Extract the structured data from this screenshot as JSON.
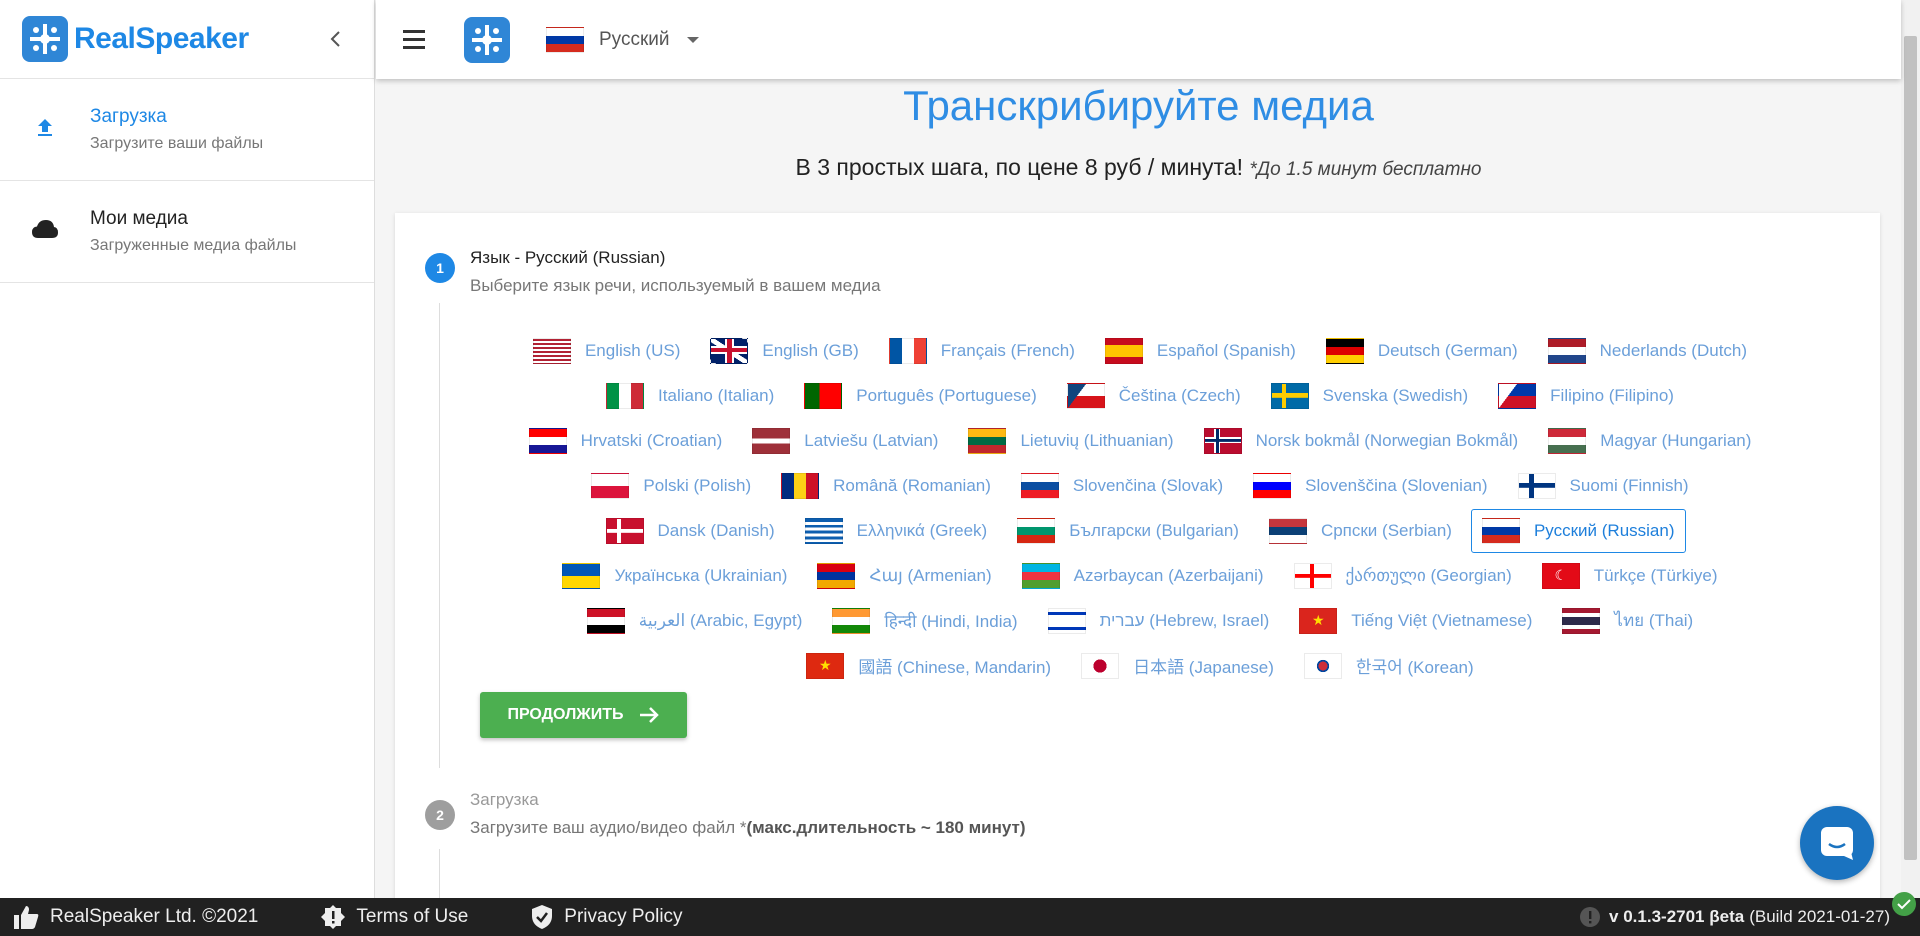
{
  "app": {
    "name": "RealSpeaker",
    "brand_color": "#1e88e5"
  },
  "sidebar": {
    "items": [
      {
        "title": "Загрузка",
        "subtitle": "Загрузите ваши файлы",
        "icon": "upload-icon",
        "active": true
      },
      {
        "title": "Мои медиа",
        "subtitle": "Загруженные медиа файлы",
        "icon": "cloud-icon",
        "active": false
      }
    ]
  },
  "topbar": {
    "selected_language": "Русский",
    "flag": "ru"
  },
  "hero": {
    "title": "Транскрибируйте медиа",
    "subtitle": "В 3 простых шага, по цене 8 руб / минута!",
    "note": "*До 1.5 минут бесплатно"
  },
  "steps": [
    {
      "num": "1",
      "title": "Язык - Русский (Russian)",
      "subtitle": "Выберите язык речи, используемый в вашем медиа"
    },
    {
      "num": "2",
      "title": "Загрузка",
      "subtitle": "Загрузите ваш аудио/видео файл *",
      "subtitle_bold": "(макс.длительность ~ 180 минут)"
    }
  ],
  "languages": [
    [
      {
        "label": "English (US)",
        "flag": "us"
      },
      {
        "label": "English (GB)",
        "flag": "gb"
      },
      {
        "label": "Français (French)",
        "flag": "fr"
      },
      {
        "label": "Español (Spanish)",
        "flag": "es"
      },
      {
        "label": "Deutsch (German)",
        "flag": "de"
      },
      {
        "label": "Nederlands (Dutch)",
        "flag": "nl"
      }
    ],
    [
      {
        "label": "Italiano (Italian)",
        "flag": "it"
      },
      {
        "label": "Português (Portuguese)",
        "flag": "pt"
      },
      {
        "label": "Čeština (Czech)",
        "flag": "cz"
      },
      {
        "label": "Svenska (Swedish)",
        "flag": "se"
      },
      {
        "label": "Filipino (Filipino)",
        "flag": "ph"
      }
    ],
    [
      {
        "label": "Hrvatski (Croatian)",
        "flag": "hr"
      },
      {
        "label": "Latviešu (Latvian)",
        "flag": "lv"
      },
      {
        "label": "Lietuvių (Lithuanian)",
        "flag": "lt"
      },
      {
        "label": "Norsk bokmål (Norwegian Bokmål)",
        "flag": "no"
      },
      {
        "label": "Magyar (Hungarian)",
        "flag": "hu"
      }
    ],
    [
      {
        "label": "Polski (Polish)",
        "flag": "pl"
      },
      {
        "label": "Română (Romanian)",
        "flag": "ro"
      },
      {
        "label": "Slovenčina (Slovak)",
        "flag": "sk"
      },
      {
        "label": "Slovenščina (Slovenian)",
        "flag": "si"
      },
      {
        "label": "Suomi (Finnish)",
        "flag": "fi"
      }
    ],
    [
      {
        "label": "Dansk (Danish)",
        "flag": "dk"
      },
      {
        "label": "Ελληνικά (Greek)",
        "flag": "gr"
      },
      {
        "label": "Български (Bulgarian)",
        "flag": "bg"
      },
      {
        "label": "Српски (Serbian)",
        "flag": "rs"
      },
      {
        "label": "Русский (Russian)",
        "flag": "ru",
        "selected": true
      }
    ],
    [
      {
        "label": "Українська (Ukrainian)",
        "flag": "ua"
      },
      {
        "label": "Հայ (Armenian)",
        "flag": "am"
      },
      {
        "label": "Azərbaycan (Azerbaijani)",
        "flag": "az"
      },
      {
        "label": "ქართული (Georgian)",
        "flag": "ge"
      },
      {
        "label": "Türkçe (Türkiye)",
        "flag": "tr"
      }
    ],
    [
      {
        "label": "العربية (Arabic, Egypt)",
        "flag": "eg"
      },
      {
        "label": "हिन्दी (Hindi, India)",
        "flag": "in"
      },
      {
        "label": "עברית (Hebrew, Israel)",
        "flag": "il"
      },
      {
        "label": "Tiếng Việt (Vietnamese)",
        "flag": "vn"
      },
      {
        "label": "ไทย (Thai)",
        "flag": "th"
      }
    ],
    [
      {
        "label": "國語 (Chinese, Mandarin)",
        "flag": "cn"
      },
      {
        "label": "日本語 (Japanese)",
        "flag": "jp"
      },
      {
        "label": "한국어 (Korean)",
        "flag": "kr"
      }
    ]
  ],
  "continue_button": {
    "label": "ПРОДОЛЖИТЬ"
  },
  "footer": {
    "company": "RealSpeaker Ltd. ©2021",
    "terms": "Terms of Use",
    "privacy": "Privacy Policy",
    "version": "v 0.1.3-2701 βeta",
    "build": "(Build 2021-01-27)"
  }
}
